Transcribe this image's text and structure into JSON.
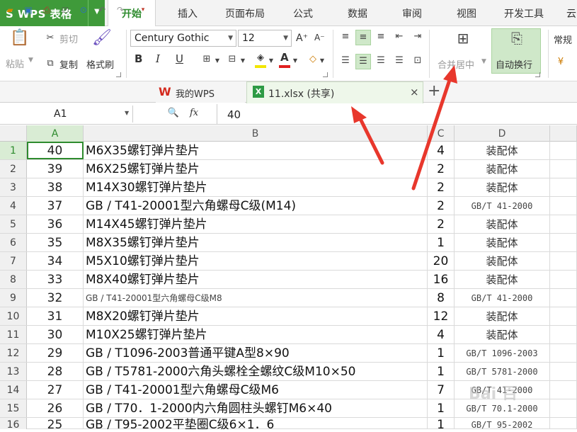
{
  "app": {
    "logo_text": "S WPS 表格",
    "logo_dropdown": "▼"
  },
  "menu": [
    "开始",
    "插入",
    "页面布局",
    "公式",
    "数据",
    "审阅",
    "视图",
    "开发工具",
    "云"
  ],
  "ribbon": {
    "paste": "粘贴",
    "cut": "剪切",
    "copy": "复制",
    "format_painter": "格式刷",
    "font_name": "Century Gothic",
    "font_size": "12",
    "bold": "B",
    "italic": "I",
    "underline": "U",
    "font_grow": "A⁺",
    "font_shrink": "A⁻",
    "merge_center": "合并居中",
    "wrap_text": "自动换行",
    "number_format": "常规"
  },
  "tabs": {
    "home_tab": "我的WPS",
    "file_tab": "11.xlsx (共享)",
    "close": "×",
    "add": "+"
  },
  "formula_bar": {
    "cell_ref": "A1",
    "fx": "fx",
    "value": "40"
  },
  "columns": [
    "A",
    "B",
    "C",
    "D"
  ],
  "rows": [
    {
      "n": "1",
      "a": "40",
      "b": "M6X35螺钉弹片垫片",
      "c": "4",
      "d": "装配体"
    },
    {
      "n": "2",
      "a": "39",
      "b": "M6X25螺钉弹片垫片",
      "c": "2",
      "d": "装配体"
    },
    {
      "n": "3",
      "a": "38",
      "b": "M14X30螺钉弹片垫片",
      "c": "2",
      "d": "装配体"
    },
    {
      "n": "4",
      "a": "37",
      "b": "GB / T41-20001型六角螺母C级(M14)",
      "c": "2",
      "d": "GB/T 41-2000"
    },
    {
      "n": "5",
      "a": "36",
      "b": "M14X45螺钉弹片垫片",
      "c": "2",
      "d": "装配体"
    },
    {
      "n": "6",
      "a": "35",
      "b": "M8X35螺钉弹片垫片",
      "c": "1",
      "d": "装配体"
    },
    {
      "n": "7",
      "a": "34",
      "b": "M5X10螺钉弹片垫片",
      "c": "20",
      "d": "装配体"
    },
    {
      "n": "8",
      "a": "33",
      "b": "M8X40螺钉弹片垫片",
      "c": "16",
      "d": "装配体"
    },
    {
      "n": "9",
      "a": "32",
      "b": "GB / T41-20001型六角螺母C级M8",
      "c": "8",
      "d": "GB/T 41-2000"
    },
    {
      "n": "10",
      "a": "31",
      "b": "M8X20螺钉弹片垫片",
      "c": "12",
      "d": "装配体"
    },
    {
      "n": "11",
      "a": "30",
      "b": "M10X25螺钉弹片垫片",
      "c": "4",
      "d": "装配体"
    },
    {
      "n": "12",
      "a": "29",
      "b": "GB / T1096-2003普通平键A型8×90",
      "c": "1",
      "d": "GB/T 1096-2003"
    },
    {
      "n": "13",
      "a": "28",
      "b": "GB / T5781-2000六角头螺栓全螺纹C级M10×50",
      "c": "1",
      "d": "GB/T 5781-2000"
    },
    {
      "n": "14",
      "a": "27",
      "b": "GB / T41-20001型六角螺母C级M6",
      "c": "7",
      "d": "GB/T 41-2000"
    },
    {
      "n": "15",
      "a": "26",
      "b": "GB / T70．1-2000内六角圆柱头螺钉M6×40",
      "c": "1",
      "d": "GB/T 70.1-2000"
    },
    {
      "n": "16",
      "a": "25",
      "b": "GB / T95-2002平垫圈C级6×1．6",
      "c": "1",
      "d": "GB/T 95-2002"
    }
  ],
  "watermark": "Bai 百",
  "colors": {
    "brand": "#3f9a3a",
    "active_tab": "#2e8b2e",
    "arrow": "#e8372c",
    "highlight": "#cfe8c9"
  }
}
